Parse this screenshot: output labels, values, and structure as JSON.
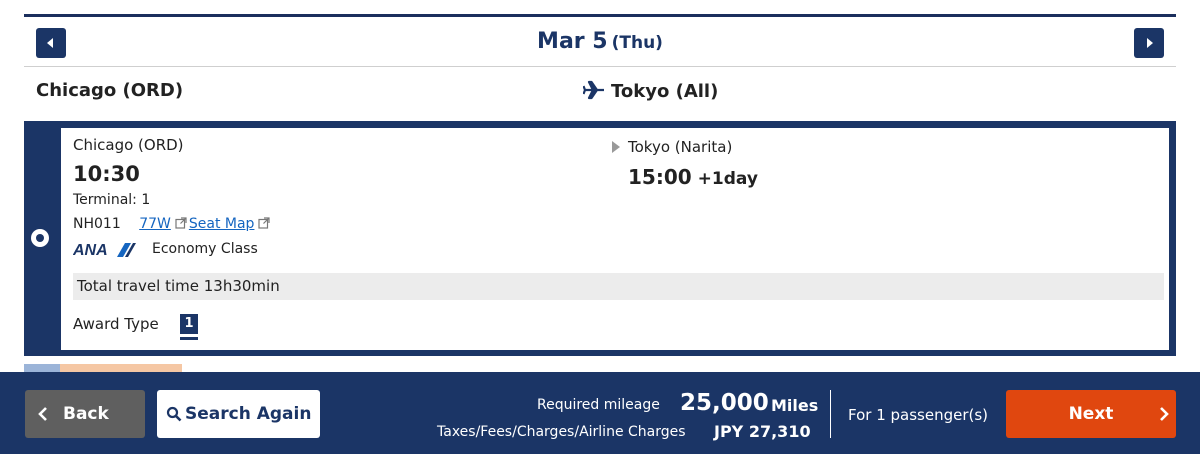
{
  "header": {
    "date": "Mar 5",
    "day_of_week": "(Thu)"
  },
  "route": {
    "origin": "Chicago (ORD)",
    "destination": "Tokyo (All)"
  },
  "flight": {
    "departure_city": "Chicago (ORD)",
    "departure_time": "10:30",
    "terminal": "Terminal: 1",
    "flight_number": "NH011",
    "aircraft": "77W",
    "seat_map_label": "Seat Map",
    "airline_logo": "ANA",
    "cabin": "Economy Class",
    "arrival_city": "Tokyo (Narita)",
    "arrival_time": "15:00",
    "arrival_day_offset": "+1day",
    "total_travel_time": "Total travel time 13h30min",
    "award_type_label": "Award Type",
    "award_type_value": "1"
  },
  "footer": {
    "back_label": "Back",
    "search_again_label": "Search Again",
    "required_mileage_label": "Required mileage",
    "required_mileage_value": "25,000",
    "mileage_unit": "Miles",
    "taxes_label": "Taxes/Fees/Charges/Airline Charges",
    "taxes_value": "JPY 27,310",
    "passengers": "For 1 passenger(s)",
    "next_label": "Next"
  },
  "icons": {
    "prev": "chevron-left-icon",
    "next": "chevron-right-icon",
    "plane": "airplane-icon",
    "external": "external-link-icon",
    "search": "search-icon",
    "arrow": "triangle-right-icon"
  },
  "colors": {
    "navy": "#1b3566",
    "accent_orange": "#e0470f",
    "link_blue": "#1565c0",
    "button_gray": "#5f5f5f"
  }
}
